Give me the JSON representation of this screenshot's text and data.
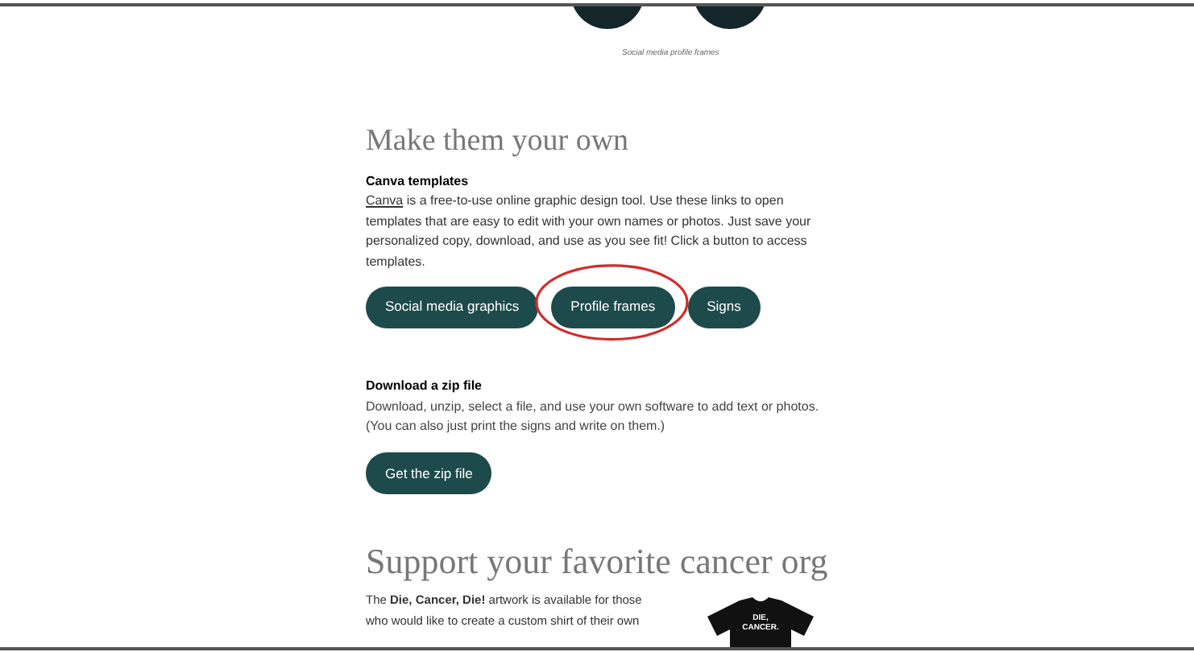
{
  "gallery": {
    "caption": "Social media profile frames"
  },
  "make_own": {
    "heading": "Make them your own",
    "canva": {
      "title": "Canva templates",
      "link": "Canva",
      "text": " is a free-to-use online graphic design tool. Use these links to open templates that are easy to edit with your own names or photos. Just save your personalized copy, download, and use as you see fit! Click a button to access templates.",
      "buttons": [
        {
          "label": "Social media graphics",
          "highlighted": false
        },
        {
          "label": "Profile frames",
          "highlighted": true
        },
        {
          "label": "Signs",
          "highlighted": false
        }
      ]
    },
    "zip": {
      "title": "Download a zip file",
      "text": "Download, unzip, select a file, and use your own software to add text or photos. (You can also just print the signs and write on them.)",
      "button": "Get the zip file"
    }
  },
  "support": {
    "heading": "Support your favorite cancer org",
    "text": "The **Die, Cancer, Die!** artwork is available for those who would like to create a custom shirt of their own",
    "shirt_text": [
      "DIE,",
      "CANCER."
    ]
  }
}
